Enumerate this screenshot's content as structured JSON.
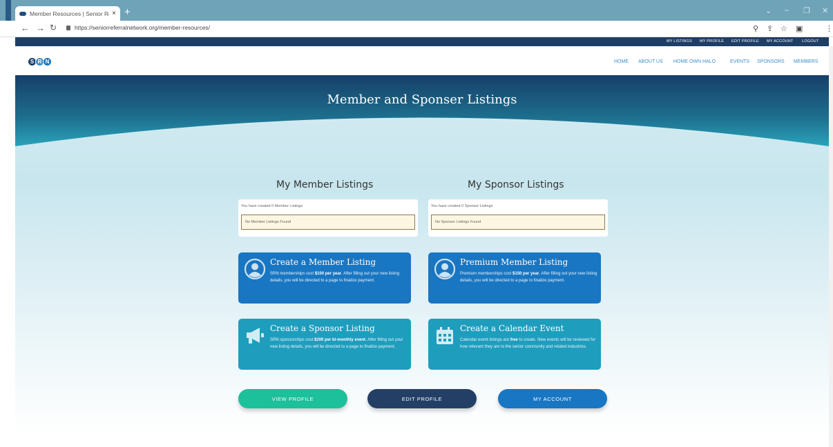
{
  "browser": {
    "tab_title": "Member Resources | Senior Refer",
    "tab_close": "×",
    "new_tab": "+",
    "url": "https://seniorreferralnetwork.org/member-resources/",
    "window_controls": [
      "⌄",
      "–",
      "❐",
      "✕"
    ]
  },
  "utility_nav": [
    "MY LISTINGS",
    "MY PROFILE",
    "EDIT PROFILE",
    "MY ACCOUNT",
    "LOGOUT"
  ],
  "logo": {
    "letters": [
      "S",
      "R",
      "N"
    ],
    "colors": [
      "#1e3e66",
      "#3a8fc7",
      "#1976c2"
    ]
  },
  "main_nav": [
    "HOME",
    "ABOUT US",
    "HOME OWN HALO",
    "EVENTS",
    "SPONSORS",
    "MEMBERS"
  ],
  "hero": {
    "title": "Member and Sponser Listings"
  },
  "member_listings": {
    "title": "My Member Listings",
    "count_text": "You have created 0 Member Listings",
    "empty_text": "No Member Listings Found"
  },
  "sponsor_listings": {
    "title": "My Sponsor Listings",
    "count_text": "You have created 0 Sponsor Listings",
    "empty_text": "No Sponsor Listings Found"
  },
  "cards": {
    "member": {
      "title": "Create a Member Listing",
      "desc_pre": "SRN memberships cost ",
      "desc_bold": "$100 per year",
      "desc_post": ". After filling out your new listing details, you will be directed to a page to finalize payment.",
      "icon": "user-circle-icon"
    },
    "premium": {
      "title": "Premium Member Listing",
      "desc_pre": "Premium memberships cost ",
      "desc_bold": "$150 per year",
      "desc_post": ". After filling out your new listing details, you will be directed to a page to finalize payment.",
      "icon": "user-circle-icon"
    },
    "sponsor": {
      "title": "Create a Sponsor Listing",
      "desc_pre": "SRN sponsorships cost ",
      "desc_bold": "$200 per bi-monthly event",
      "desc_post": ". After filling out your new listing details, you will be directed to a page to finalize payment.",
      "icon": "megaphone-icon"
    },
    "event": {
      "title": "Create a Calendar Event",
      "desc_pre": "Calendar event listings are ",
      "desc_bold": "free",
      "desc_post": " to create. New events will be reviewed for how relevant they are to the senior community and related industries.",
      "icon": "calendar-icon"
    }
  },
  "buttons": {
    "view_profile": "VIEW PROFILE",
    "edit_profile": "EDIT PROFILE",
    "my_account": "MY ACCOUNT"
  },
  "colors": {
    "navy": "#1e3e66",
    "card_blue": "#1976c2",
    "card_teal": "#1f9dbd",
    "button_green": "#1cc09a",
    "button_navy": "#233f66",
    "button_blue": "#1976c2"
  }
}
